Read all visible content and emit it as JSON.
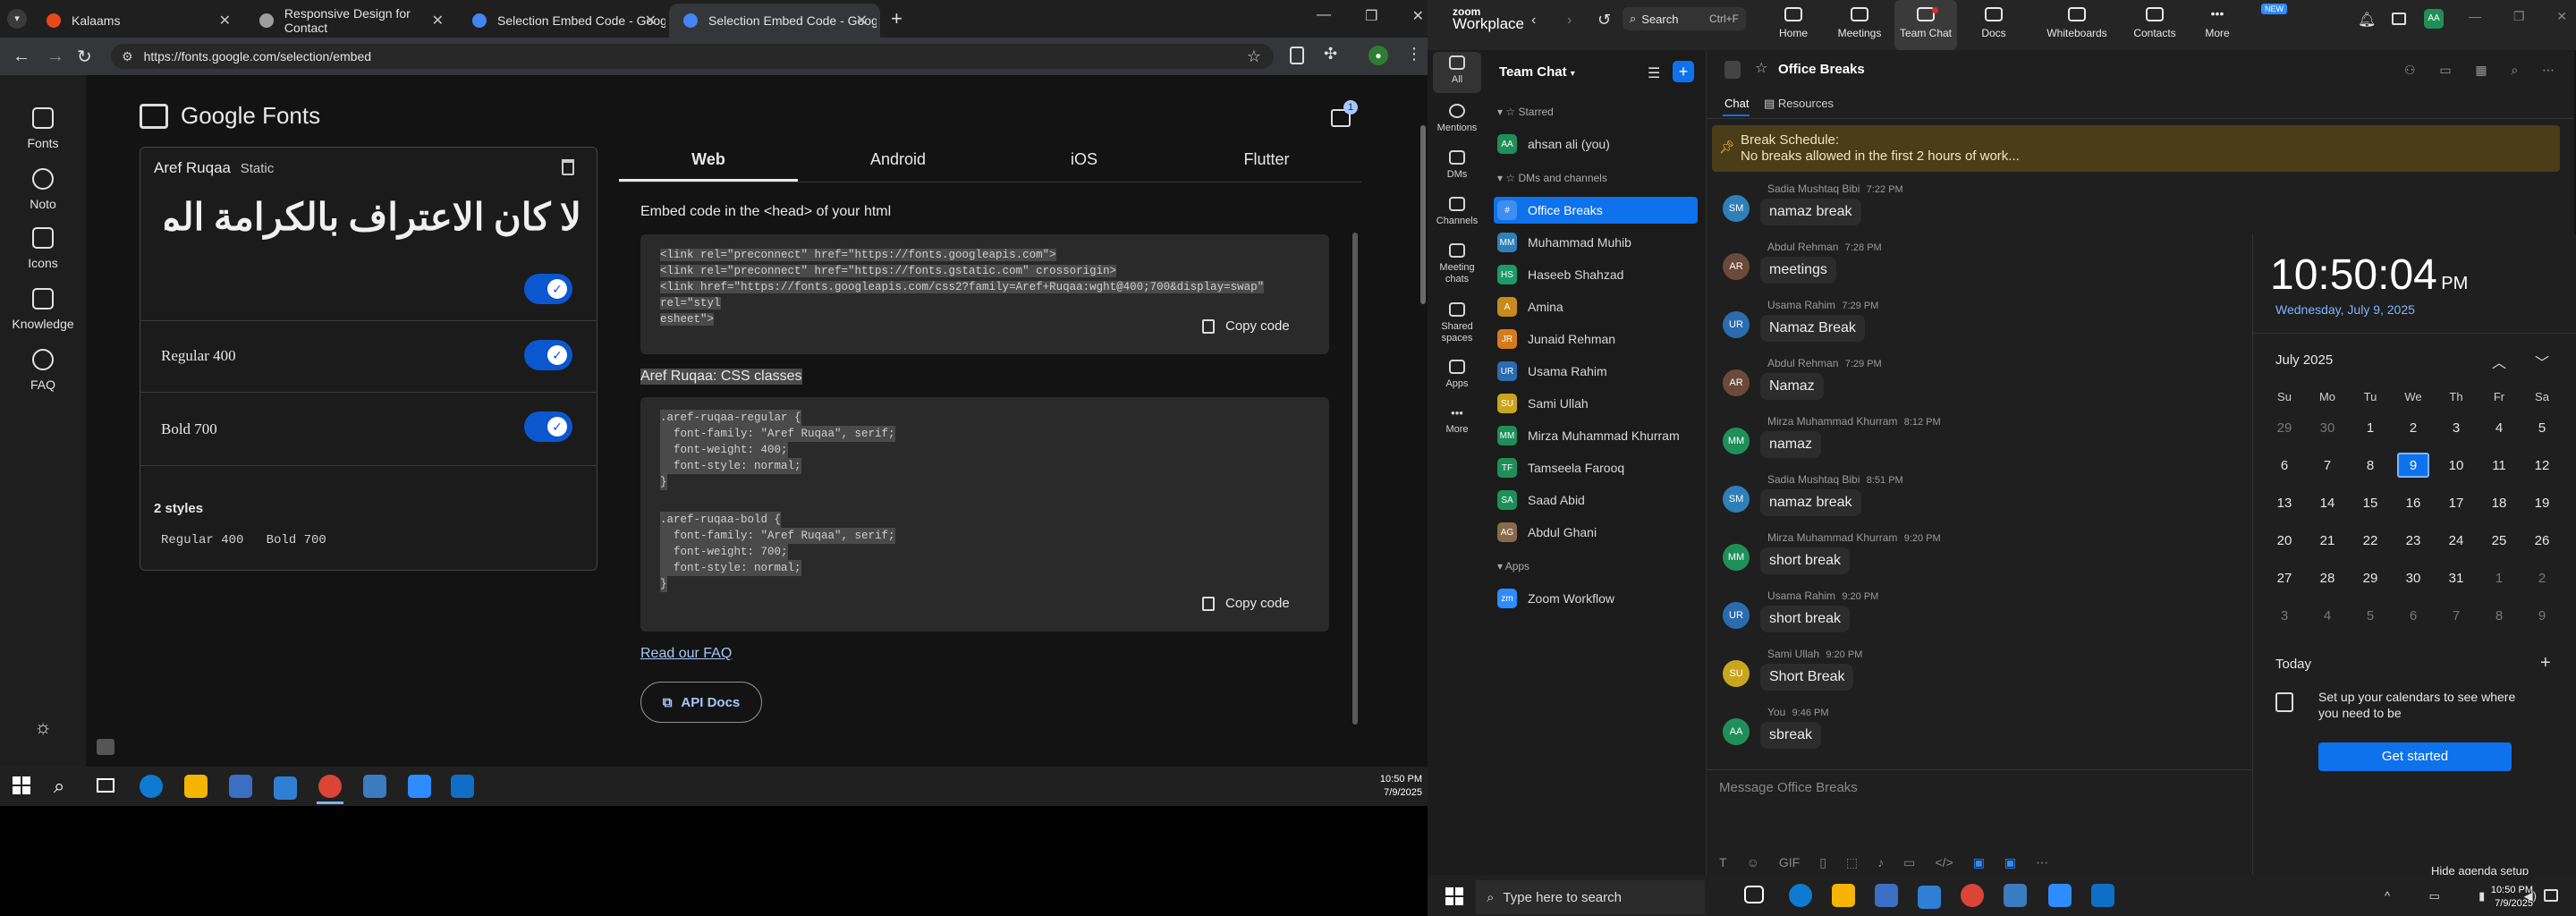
{
  "browser": {
    "tabs": [
      {
        "label": "Kalaams",
        "color": "#e64a19"
      },
      {
        "label": "Responsive Design for Contact",
        "color": "#9e9e9e"
      },
      {
        "label": "Selection Embed Code - Google",
        "color": "#4285f4"
      },
      {
        "label": "Selection Embed Code - Google",
        "color": "#4285f4"
      }
    ],
    "url": "https://fonts.google.com/selection/embed"
  },
  "gf": {
    "logo": "Google Fonts",
    "bag_count": "1",
    "rail": [
      "Fonts",
      "Noto",
      "Icons",
      "Knowledge",
      "FAQ"
    ],
    "family": "Aref Ruqaa",
    "family_tag": "Static",
    "arabic_sample": "لا كان الاعتراف بالكرامة المتأصلة في جميع",
    "styles": [
      "Regular 400",
      "Bold 700"
    ],
    "count_label": "2 styles",
    "count_values": "Regular 400   Bold 700",
    "tabs": [
      "Web",
      "Android",
      "iOS",
      "Flutter"
    ],
    "embed_heading": "Embed code in the <head> of your html",
    "embed_code": [
      "<link rel=\"preconnect\" href=\"https://fonts.googleapis.com\">",
      "<link rel=\"preconnect\" href=\"https://fonts.gstatic.com\" crossorigin>",
      "<link href=\"https://fonts.googleapis.com/css2?family=Aref+Ruqaa:wght@400;700&display=swap\" rel=\"styl",
      "esheet\">"
    ],
    "copy_label": "Copy code",
    "css_heading": "Aref Ruqaa: CSS classes",
    "css_code": [
      ".aref-ruqaa-regular {",
      "  font-family: \"Aref Ruqaa\", serif;",
      "  font-weight: 400;",
      "  font-style: normal;",
      "}",
      "",
      ".aref-ruqaa-bold {",
      "  font-family: \"Aref Ruqaa\", serif;",
      "  font-weight: 700;",
      "  font-style: normal;",
      "}"
    ],
    "faq_link": "Read our FAQ",
    "api_button": "API Docs"
  },
  "taskbar_left": {
    "time": "10:50 PM",
    "date": "7/9/2025"
  },
  "zoom": {
    "brand_top": "zoom",
    "brand_bottom": "Workplace",
    "search": "Search",
    "shortcut": "Ctrl+F",
    "top_tabs": [
      "Home",
      "Meetings",
      "Team Chat",
      "Docs",
      "Whiteboards",
      "Contacts",
      "More"
    ],
    "new_badge": "NEW",
    "nav": [
      "All",
      "Mentions",
      "DMs",
      "Channels",
      "Meeting chats",
      "Shared spaces",
      "Apps",
      "More"
    ],
    "panel_title": "Team Chat",
    "starred": "Starred",
    "me": "ahsan ali (you)",
    "dms_label": "DMs and channels",
    "contacts": [
      {
        "name": "Office Breaks",
        "ini": "",
        "color": "#2d8cff"
      },
      {
        "name": "Muhammad Muhib",
        "ini": "MM",
        "color": "#2f7fb8"
      },
      {
        "name": "Haseeb Shahzad",
        "ini": "HS",
        "color": "#1c9a6b"
      },
      {
        "name": "Amina",
        "ini": "A",
        "color": "#c98a1d"
      },
      {
        "name": "Junaid Rehman",
        "ini": "JR",
        "color": "#d87a1a"
      },
      {
        "name": "Usama Rahim",
        "ini": "UR",
        "color": "#2b6cb0"
      },
      {
        "name": "Sami Ullah",
        "ini": "SU",
        "color": "#c9a61b"
      },
      {
        "name": "Mirza Muhammad Khurram",
        "ini": "MM",
        "color": "#1f8f5a"
      },
      {
        "name": "Tamseela Farooq",
        "ini": "TF",
        "color": "#1f8f5a"
      },
      {
        "name": "Saad Abid",
        "ini": "SA",
        "color": "#1f8f5a"
      },
      {
        "name": "Abdul Ghani",
        "ini": "AG",
        "color": "#8a6a4a"
      }
    ],
    "apps_label": "Apps",
    "app": "Zoom Workflow",
    "channel": "Office Breaks",
    "chat_tabs": [
      "Chat",
      "Resources"
    ],
    "banner_title": "Break Schedule:",
    "banner_body": "No breaks allowed in the first 2 hours of work...",
    "messages": [
      {
        "who": "Sadia Mushtaq Bibi",
        "time": "7:22 PM",
        "text": "namaz break",
        "ini": "SM",
        "color": "#2f7fb8"
      },
      {
        "who": "Abdul Rehman",
        "time": "7:28 PM",
        "text": "meetings",
        "ini": "AR",
        "color": "#6b4a3a"
      },
      {
        "who": "Usama Rahim",
        "time": "7:29 PM",
        "text": "Namaz Break",
        "ini": "UR",
        "color": "#2b6cb0"
      },
      {
        "who": "Abdul Rehman",
        "time": "7:29 PM",
        "text": "Namaz",
        "ini": "AR",
        "color": "#6b4a3a"
      },
      {
        "who": "Mirza Muhammad Khurram",
        "time": "8:12 PM",
        "text": "namaz",
        "ini": "MM",
        "color": "#1f8f5a"
      },
      {
        "who": "Sadia Mushtaq Bibi",
        "time": "8:51 PM",
        "text": "namaz break",
        "ini": "SM",
        "color": "#2f7fb8"
      },
      {
        "who": "Mirza Muhammad Khurram",
        "time": "9:20 PM",
        "text": "short break",
        "ini": "MM",
        "color": "#1f8f5a"
      },
      {
        "who": "Usama Rahim",
        "time": "9:20 PM",
        "text": "short break",
        "ini": "UR",
        "color": "#2b6cb0"
      },
      {
        "who": "Sami Ullah",
        "time": "9:20 PM",
        "text": "Short Break",
        "ini": "SU",
        "color": "#c9a61b"
      },
      {
        "who": "You",
        "time": "9:46 PM",
        "text": "sbreak",
        "ini": "AA",
        "color": "#1f8f5a"
      }
    ],
    "composer": "Message Office Breaks",
    "clock": {
      "time": "10:50:04",
      "ampm": "PM",
      "date": "Wednesday, July 9, 2025",
      "month": "July 2025",
      "weekdays": [
        "Su",
        "Mo",
        "Tu",
        "We",
        "Th",
        "Fr",
        "Sa"
      ],
      "rows": [
        [
          "29",
          "30",
          "1",
          "2",
          "3",
          "4",
          "5"
        ],
        [
          "6",
          "7",
          "8",
          "9",
          "10",
          "11",
          "12"
        ],
        [
          "13",
          "14",
          "15",
          "16",
          "17",
          "18",
          "19"
        ],
        [
          "20",
          "21",
          "22",
          "23",
          "24",
          "25",
          "26"
        ],
        [
          "27",
          "28",
          "29",
          "30",
          "31",
          "1",
          "2"
        ],
        [
          "3",
          "4",
          "5",
          "6",
          "7",
          "8",
          "9"
        ]
      ],
      "selected": "9",
      "today": "Today",
      "prompt": "Set up your calendars to see where you need to be",
      "cta": "Get started",
      "hide": "Hide agenda setup"
    },
    "taskbar": {
      "search": "Type here to search",
      "time": "10:50 PM",
      "date": "7/9/2025"
    }
  }
}
